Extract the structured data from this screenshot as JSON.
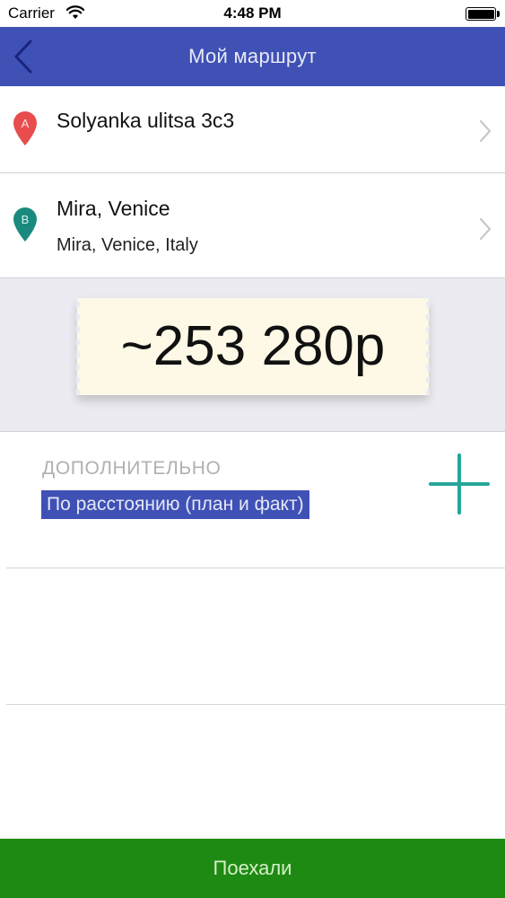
{
  "status_bar": {
    "carrier": "Carrier",
    "time": "4:48 PM",
    "battery_level": 1.0
  },
  "nav": {
    "title": "Мой маршрут",
    "back_icon": "chevron-left-icon"
  },
  "route": {
    "point_a": {
      "marker": "A",
      "marker_color": "#e84c4c",
      "title": "Solyanka ulitsa 3c3"
    },
    "point_b": {
      "marker": "B",
      "marker_color": "#1a8a7e",
      "title": "Mira, Venice",
      "subtitle": "Mira, Venice, Italy"
    }
  },
  "price": {
    "value": "~253 280р"
  },
  "extra": {
    "heading": "ДОПОЛНИТЕЛЬНО",
    "tag": "По расстоянию (план и факт)",
    "add_icon": "plus-icon"
  },
  "footer": {
    "go_label": "Поехали"
  },
  "colors": {
    "nav_bg": "#3f51b5",
    "accent_teal": "#26a69a",
    "go_button_bg": "#1e8a14",
    "price_area_bg": "#ebebf1"
  }
}
